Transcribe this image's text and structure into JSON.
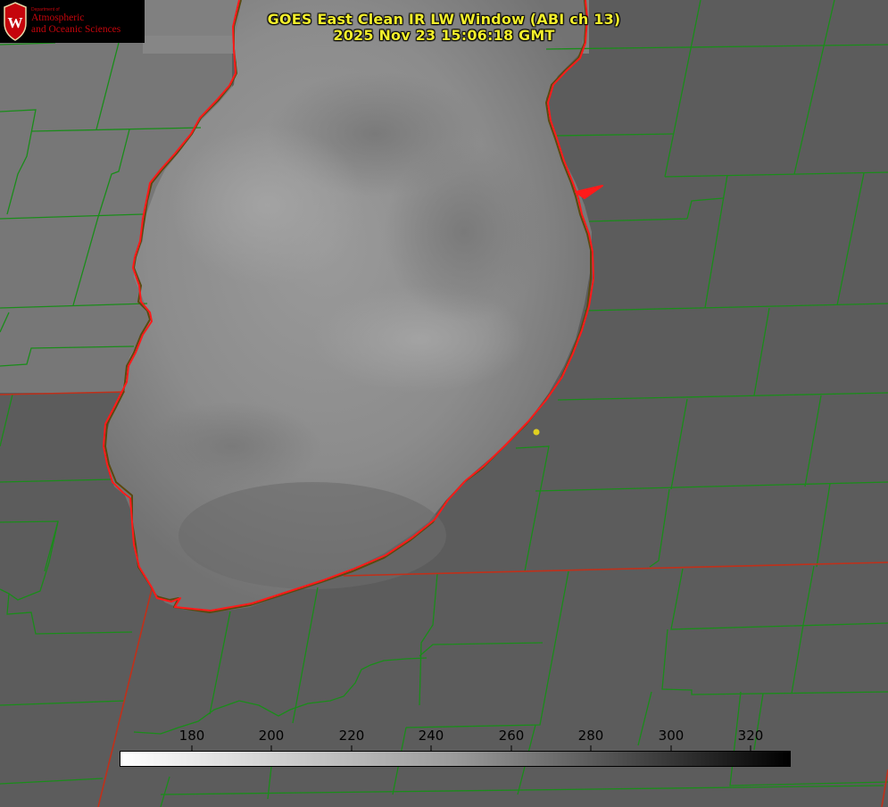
{
  "header": {
    "title_line1": "GOES East Clean IR LW Window (ABI ch 13)",
    "title_line2": "2025 Nov 23 15:06:18 GMT"
  },
  "logo": {
    "crest_letter": "W",
    "dept_text": "Department of",
    "line1": "Atmospheric",
    "line2": "and Oceanic Sciences",
    "color": "#c5050c"
  },
  "map": {
    "background_color": "#595959",
    "lake_color": "#8a8a8a",
    "county_border_color": "#1a8c1a",
    "state_border_color": "#c02a10",
    "shoreline_color": "#ff1a1a",
    "marker_color": "#e0d020"
  },
  "colorbar": {
    "ticks": [
      "180",
      "200",
      "220",
      "240",
      "260",
      "280",
      "300",
      "320"
    ],
    "gradient_start": "#ffffff",
    "gradient_end": "#000000"
  }
}
